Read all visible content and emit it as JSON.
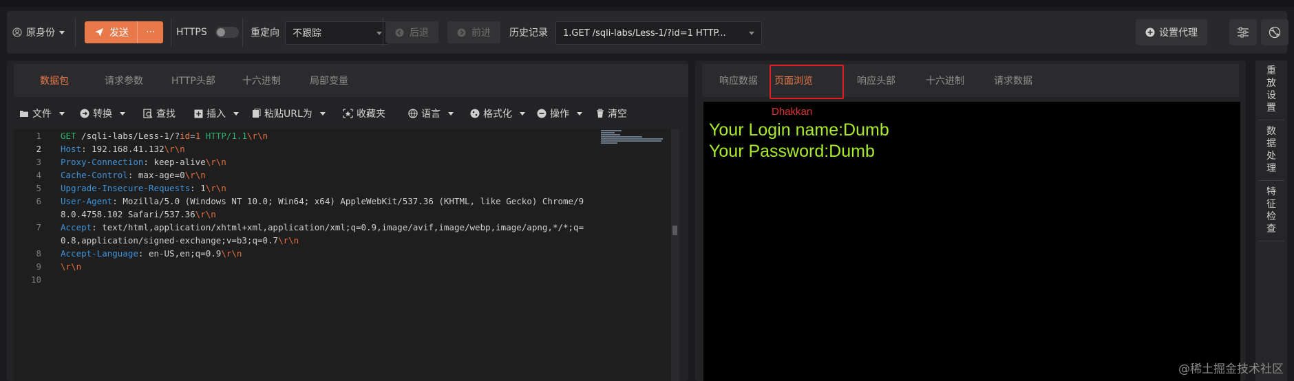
{
  "toolbar": {
    "identity_label": "原身份",
    "send_label": "发送",
    "send_more": "···",
    "https_label": "HTTPS",
    "redirect_label": "重定向",
    "redirect_value": "不跟踪",
    "back_label": "后退",
    "forward_label": "前进",
    "history_label": "历史记录",
    "history_value": "1.GET /sqli-labs/Less-1/?id=1 HTTP...",
    "proxy_label": "设置代理",
    "colors": {
      "accent": "#e8794a"
    }
  },
  "request_panel": {
    "tabs": [
      "数据包",
      "请求参数",
      "HTTP头部",
      "十六进制",
      "局部变量"
    ],
    "active_tab": "数据包",
    "tools": [
      "文件",
      "转换",
      "查找",
      "插入",
      "粘贴URL为",
      "收藏夹",
      "语言",
      "格式化",
      "操作",
      "清空"
    ],
    "line_numbers": [
      "1",
      "2",
      "3",
      "4",
      "5",
      "6",
      "7",
      "8",
      "9",
      "10"
    ],
    "code": {
      "l1_method": "GET ",
      "l1_path": "/sqli-labs/Less-1/?",
      "l1_param": "id",
      "l1_eq": "=",
      "l1_val": "1",
      "l1_ver": " HTTP/1.1",
      "crlf": "\\r\\n",
      "l2_key": "Host",
      "l2_val": ": 192.168.41.132",
      "l3_key": "Proxy-Connection",
      "l3_val": ": keep-alive",
      "l4_key": "Cache-Control",
      "l4_val": ": max-age=0",
      "l5_key": "Upgrade-Insecure-Requests",
      "l5_val": ": 1",
      "l6_key": "User-Agent",
      "l6_val": ": Mozilla/5.0 (Windows NT 10.0; Win64; x64) AppleWebKit/537.36 (KHTML, like Gecko) Chrome/9",
      "l6_cont": "8.0.4758.102 Safari/537.36",
      "l7_key": "Accept",
      "l7_val": ": text/html,application/xhtml+xml,application/xml;q=0.9,image/avif,image/webp,image/apng,*/*;q=",
      "l7_cont": "0.8,application/signed-exchange;v=b3;q=0.7",
      "l8_key": "Accept-Language",
      "l8_val": ": en-US,en;q=0.9"
    }
  },
  "response_panel": {
    "tabs": [
      "响应数据",
      "页面浏览",
      "响应头部",
      "十六进制",
      "请求数据"
    ],
    "active_tab": "页面浏览",
    "page_title": "Dhakkan",
    "login_line": "Your Login name:Dumb",
    "password_line": "Your Password:Dumb"
  },
  "sidebar": {
    "items": [
      "重\n放\n设\n置",
      "数\n据\n处\n理",
      "特\n征\n检\n查"
    ]
  },
  "watermark": "@稀土掘金技术社区"
}
